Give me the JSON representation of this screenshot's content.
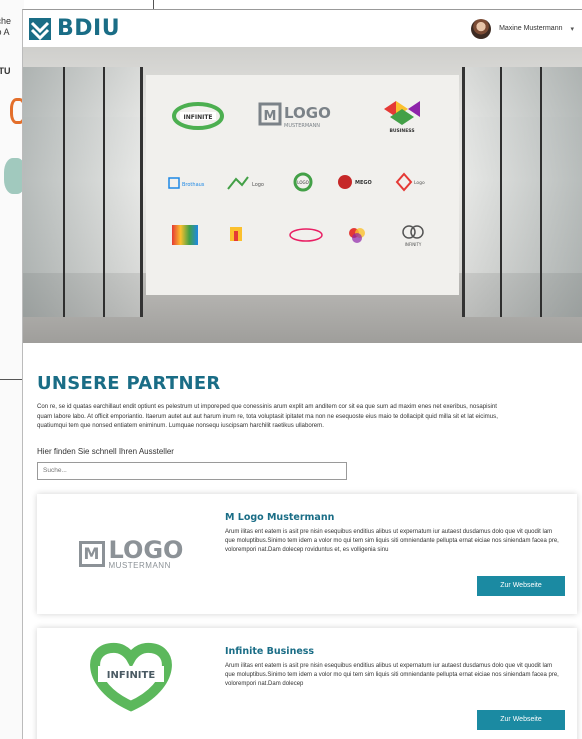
{
  "background": {
    "texts": [
      "sche",
      "so A",
      "NTU"
    ]
  },
  "header": {
    "brand": "BDIU",
    "user_name": "Maxine Mustermann",
    "caret": "▾"
  },
  "hero": {
    "wall_logos": [
      {
        "label": "INFINITE"
      },
      {
        "label": "LOGO",
        "sub": "MUSTERMANN"
      },
      {
        "label": "BUSINESS"
      },
      {
        "label": "Brothaus"
      },
      {
        "label": "Logo"
      },
      {
        "label": "LOGO"
      },
      {
        "label": "Logo"
      },
      {
        "label": "MEGO"
      },
      {
        "label": "INFINITY"
      }
    ]
  },
  "section": {
    "title": "UNSERE PARTNER",
    "intro": "Con re, se id quatas earchillaut endit optiunt es pelestrum ut imporeped que conessinis arum explit am anditem cor sit ea que sum ad maxim enes net exeribus, nosapisint quam labore labo. At officit emporiantio. Itaerum autet aut aut harum inum re, tota voluptasit ipitatet ma non ne esequoste eius maio te dollacipit quid milla sit et lat eicimus, quatiumqui tem que nonsed entiatem eniminum. Lumquae nonsequ iuscipsam harchilit raetikus ullaborem.",
    "search_label": "Hier  finden Sie schnell Ihren Aussteller",
    "search_placeholder": "Suche..."
  },
  "partners": [
    {
      "name": "M Logo Mustermann",
      "logo_box": "M",
      "logo_word": "LOGO",
      "logo_sub": "MUSTERMANN",
      "text": "Arum ilitas ent eatem is asit pre nisin esequibus enditius alibus ut expernatum iur autaest dusdamus dolo que vit quodit lam que moluptibus.Sinimo tem idem a volor mo qui tem sim liquis siti omniendante pellupta ernat eiciae nos siniendam facea pre, volorempori nat.Dam dolecep roviduntus et, es volligenia sinu",
      "button": "Zur Webseite"
    },
    {
      "name": "Infinite Business",
      "logo_word": "INFINITE",
      "text": "Arum ilitas ent eatem is asit pre nisin esequibus enditius alibus ut expernatum iur autaest dusdamus dolo que vit quodit lam que moluptibus.Sinimo tem idem a volor mo qui tem sim liquis siti omniendante pellupta ernat eiciae nos siniendam facea pre, volorempori nat.Dam dolecep",
      "button": "Zur Webseite"
    }
  ],
  "colors": {
    "brand": "#1a6d86",
    "button": "#1b8aa2"
  }
}
